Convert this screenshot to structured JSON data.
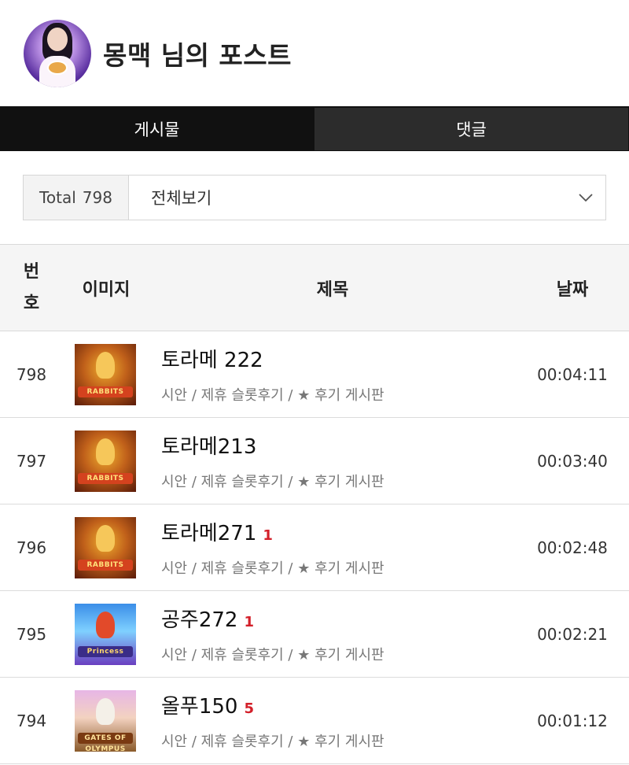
{
  "header": {
    "title": "몽맥 님의 포스트"
  },
  "tabs": [
    {
      "label": "게시물",
      "active": true
    },
    {
      "label": "댓글",
      "active": false
    }
  ],
  "filter": {
    "total_label": "Total",
    "total_count": "798",
    "select_value": "전체보기"
  },
  "columns": {
    "number": "번호",
    "number_line1": "번",
    "number_line2": "호",
    "image": "이미지",
    "title": "제목",
    "date": "날짜"
  },
  "posts": [
    {
      "number": "798",
      "title": "토라메 222",
      "comments": "",
      "board": "시안 / 제휴 슬롯후기 / ★ 후기 게시판",
      "date": "00:04:11",
      "thumb": "5 Rabbits Megaways"
    },
    {
      "number": "797",
      "title": "토라메213",
      "comments": "",
      "board": "시안 / 제휴 슬롯후기 / ★ 후기 게시판",
      "date": "00:03:40",
      "thumb": "5 Rabbits Megaways"
    },
    {
      "number": "796",
      "title": "토라메271",
      "comments": "1",
      "board": "시안 / 제휴 슬롯후기 / ★ 후기 게시판",
      "date": "00:02:48",
      "thumb": "5 Rabbits Megaways"
    },
    {
      "number": "795",
      "title": "공주272",
      "comments": "1",
      "board": "시안 / 제휴 슬롯후기 / ★ 후기 게시판",
      "date": "00:02:21",
      "thumb": "Starlight Princess"
    },
    {
      "number": "794",
      "title": "올푸150",
      "comments": "5",
      "board": "시안 / 제휴 슬롯후기 / ★ 후기 게시판",
      "date": "00:01:12",
      "thumb": "Gates of Olympus"
    }
  ],
  "thumb_logos": {
    "rabbits": "RABBITS",
    "princess": "Princess",
    "olympus": "GATES OF OLYMPUS"
  },
  "colors": {
    "tab_bar": "#111111",
    "comment_count": "#d3202a",
    "header_bg": "#f5f5f5"
  }
}
